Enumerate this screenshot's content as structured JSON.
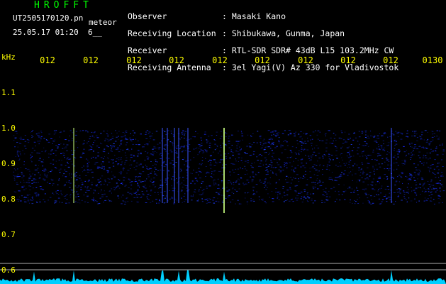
{
  "header": {
    "app_title": "HROFFT",
    "file_name": "UT2505170120.pn",
    "meteor_label": "meteor",
    "datetime": "25.05.17 01:20",
    "counter": "6__",
    "labels": [
      "Observer",
      "Receiving Location",
      "Receiver",
      "Receiving Antenna"
    ],
    "values": [
      ": Masaki Kano",
      ": Shibukawa, Gunma, Japan",
      ": RTL-SDR SDR# 43dB L15 103.2MHz CW",
      ": 3el Yagi(V) Az 330 for Vladivostok"
    ]
  },
  "time_axis": {
    "ticks": [
      "012",
      "012",
      "012",
      "012",
      "012",
      "012",
      "012",
      "012",
      "012",
      "0130"
    ]
  },
  "freq_axis": {
    "unit": "kHz",
    "ticks": [
      "1.1",
      "1.0",
      "0.9",
      "0.8",
      "0.7",
      "0.6"
    ]
  },
  "colors": {
    "text_yellow": "#ffff00",
    "text_white": "#ffffff",
    "title_green": "#00ff00",
    "signal_blue": "#1a2bff",
    "meteor_yellow": "#ffff66",
    "baseline_cyan": "#00d8ff",
    "grid_gray": "#b0b0b0"
  }
}
